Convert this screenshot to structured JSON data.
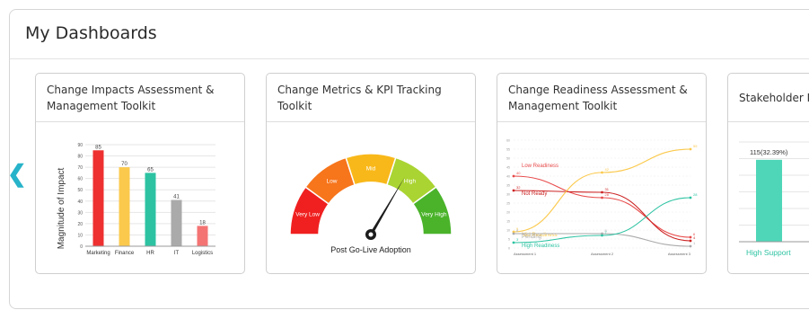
{
  "panel": {
    "title": "My Dashboards"
  },
  "nav": {
    "prev_icon": "chevron-left-icon",
    "prev_glyph": "❮"
  },
  "cards": [
    {
      "title": "Change Impacts Assessment & Management Toolkit",
      "chart": {
        "type": "bar",
        "ylabel": "Magnitude of Impact",
        "ylim": [
          0,
          90
        ],
        "yticks": [
          "0",
          "10",
          "20",
          "30",
          "40",
          "50",
          "60",
          "70",
          "80",
          "90"
        ],
        "categories": [
          "Marketing",
          "Finance",
          "HR",
          "IT",
          "Logistics"
        ],
        "values": [
          85,
          70,
          65,
          41,
          18
        ],
        "labels": [
          "85",
          "70",
          "65",
          "41",
          "18"
        ],
        "colors": [
          "#ee3030",
          "#fbc94c",
          "#2dc3a2",
          "#aaaaaa",
          "#f47474"
        ]
      }
    },
    {
      "title": "Change Metrics & KPI Tracking Toolkit",
      "gauge": {
        "segments": [
          "Very Low",
          "Low",
          "Mid",
          "High",
          "Very High"
        ],
        "colors": [
          "#f02020",
          "#f7751b",
          "#f9b81a",
          "#aad432",
          "#4ab32a"
        ],
        "value": 0.67,
        "caption": "Post Go-Live Adoption"
      }
    },
    {
      "title": "Change Readiness Assessment & Management Toolkit",
      "chart": {
        "type": "line",
        "categories": [
          "Assessment 1",
          "Assessment 2",
          "Assessment 3"
        ],
        "series": [
          {
            "name": "Low Readiness",
            "color": "#e84a4a",
            "values": [
              40,
              28,
              6
            ]
          },
          {
            "name": "Not Ready",
            "color": "#cc2222",
            "values": [
              32,
              31,
              4
            ]
          },
          {
            "name": "Mid Readiness",
            "color": "#fbc94c",
            "values": [
              9,
              42,
              55
            ]
          },
          {
            "name": "Pending",
            "color": "#aaaaaa",
            "values": [
              8,
              8,
              1
            ]
          },
          {
            "name": "High Readiness",
            "color": "#2dc3a2",
            "values": [
              3,
              7,
              28
            ]
          }
        ]
      }
    },
    {
      "title": "Stakeholder Management Toolkit",
      "chart": {
        "type": "bar",
        "categories": [
          "High Support"
        ],
        "values": [
          115
        ],
        "labels": [
          "115(32.39%)"
        ],
        "colors": [
          "#4fd6b8"
        ]
      }
    }
  ]
}
